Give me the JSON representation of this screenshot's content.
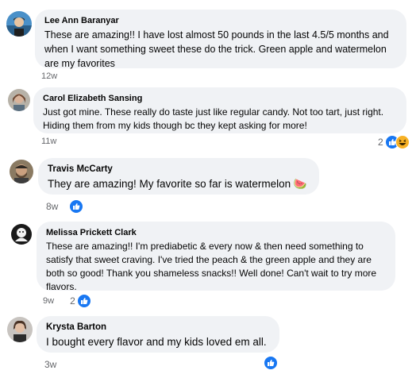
{
  "comments": [
    {
      "author": "Lee Ann Baranyar",
      "text": "These are amazing!! I have lost almost 50 pounds in the last 4.5/5 months and when I want something sweet these do the trick. Green apple and watermelon are my favorites",
      "time": "12w",
      "reactions": {
        "count": "",
        "types": []
      }
    },
    {
      "author": "Carol Elizabeth Sansing",
      "text": "Just got mine. These really do taste just like regular candy. Not too tart, just right. Hiding them from my kids though bc they kept asking for more!",
      "time": "11w",
      "reactions": {
        "count": "2",
        "types": [
          "like-icon",
          "haha-icon"
        ]
      }
    },
    {
      "author": "Travis McCarty",
      "text": "They are amazing! My favorite so far is watermelon 🍉",
      "time": "8w",
      "reactions": {
        "count": "",
        "types": [
          "like-icon"
        ]
      }
    },
    {
      "author": "Melissa Prickett Clark",
      "text": "These are amazing!! I'm prediabetic & every now & then need something to satisfy that sweet craving. I've tried the peach & the green apple and they are both so good! Thank you shameless snacks!! Well done! Can't wait to try more flavors.",
      "time": "9w",
      "reactions": {
        "count": "2",
        "types": [
          "like-icon"
        ]
      }
    },
    {
      "author": "Krysta Barton",
      "text": "I bought every flavor and my kids loved em all.",
      "time": "3w",
      "reactions": {
        "count": "",
        "types": [
          "like-icon"
        ]
      }
    }
  ],
  "colors": {
    "bubble": "#f0f2f5",
    "like": "#1877f2",
    "haha": "#f7b125",
    "meta": "#65676b"
  }
}
